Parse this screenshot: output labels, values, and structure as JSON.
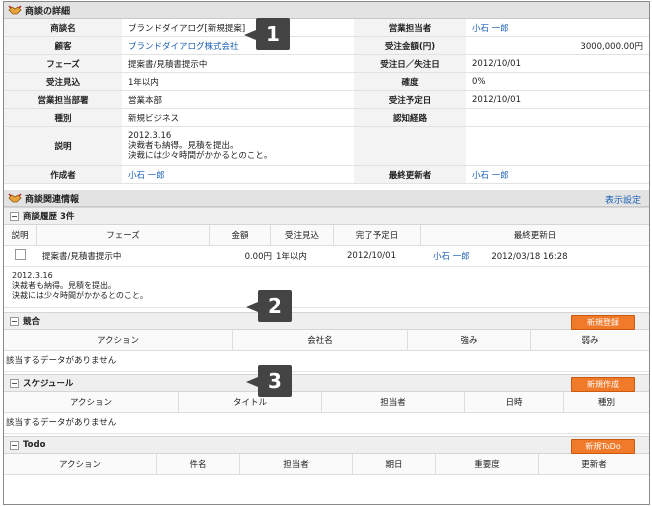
{
  "details": {
    "title": "商談の詳細",
    "rows": [
      {
        "l1": "商談名",
        "v1": "ブランドダイアログ[新規提案]",
        "l2": "営業担当者",
        "v2": "小石 一郎"
      },
      {
        "l1": "顧客",
        "v1": "ブランドダイアログ株式会社",
        "l2": "受注金額(円)",
        "v2": "3000,000.00円"
      },
      {
        "l1": "フェーズ",
        "v1": "提案書/見積書提示中",
        "l2": "受注日／失注日",
        "v2": "2012/10/01"
      },
      {
        "l1": "受注見込",
        "v1": "1年以内",
        "l2": "確度",
        "v2": "0%"
      },
      {
        "l1": "営業担当部署",
        "v1": "営業本部",
        "l2": "受注予定日",
        "v2": "2012/10/01"
      },
      {
        "l1": "種別",
        "v1": "新規ビジネス",
        "l2": "認知経路",
        "v2": ""
      }
    ],
    "desc_label": "説明",
    "desc_lines": [
      "2012.3.16",
      "決裁者も納得。見積を提出。",
      "決裁には少々時間がかかるとのこと。"
    ],
    "creator_label": "作成者",
    "creator": "小石 一郎",
    "updater_label": "最終更新者",
    "updater": "小石 一郎"
  },
  "related": {
    "title": "商談関連情報",
    "display_setting": "表示設定",
    "history": {
      "title": "商談履歴 3件",
      "headers": [
        "説明",
        "フェーズ",
        "金額",
        "受注見込",
        "完了予定日",
        "最終更新日"
      ],
      "row": {
        "phase": "提案書/見積書提示中",
        "amount": "0.00円",
        "outlook": "1年以内",
        "due": "2012/10/01",
        "user": "小石 一郎",
        "updated": "2012/03/18 16:28"
      },
      "note": [
        "2012.3.16",
        "決裁者も納得。見積を提出。",
        "決裁には少々時間がかかるとのこと。"
      ]
    },
    "competitor": {
      "title": "競合",
      "button": "新規登録",
      "headers": [
        "アクション",
        "会社名",
        "強み",
        "弱み"
      ],
      "empty": "該当するデータがありません"
    },
    "schedule": {
      "title": "スケジュール",
      "button": "新規作成",
      "headers": [
        "アクション",
        "タイトル",
        "担当者",
        "日時",
        "種別"
      ],
      "empty": "該当するデータがありません"
    },
    "todo": {
      "title": "Todo",
      "button": "新規ToDo",
      "headers": [
        "アクション",
        "件名",
        "担当者",
        "期日",
        "重要度",
        "更新者"
      ]
    }
  },
  "callouts": [
    "1",
    "2",
    "3"
  ]
}
